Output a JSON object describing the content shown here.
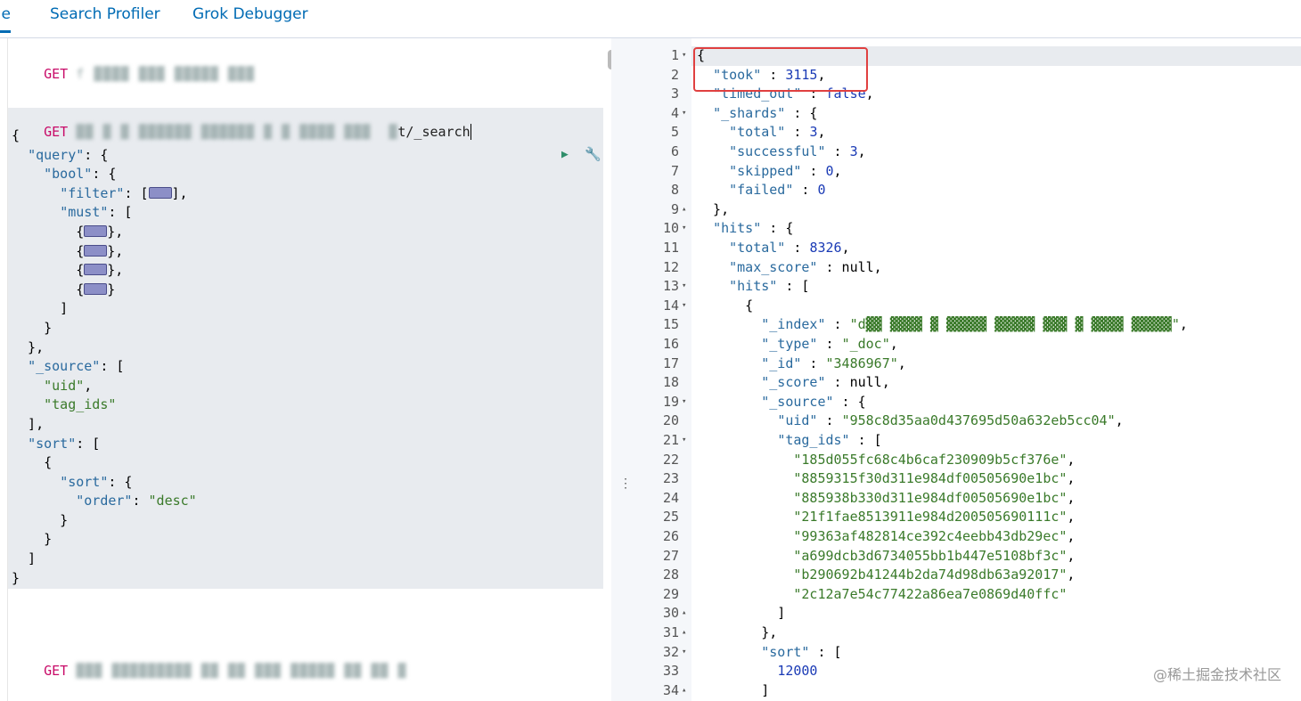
{
  "tabs": [
    {
      "label": "ble",
      "active": true
    },
    {
      "label": "Search Profiler",
      "active": false
    },
    {
      "label": "Grok Debugger",
      "active": false
    }
  ],
  "request": {
    "method": "GET",
    "first_path": "f ▓▓▓▓ ▓▓▓ ▓▓▓▓▓ ▓▓▓",
    "second_path_tail": "t/_search",
    "second_path_blur": "▓▓ ▓ ▓ ▓▓▓▓▓▓ ▓▓▓▓▓▓ ▓ ▓ ▓▓▓▓ ▓▓▓  ▓",
    "third_path": "▓▓▓ ▓▓▓▓▓▓▓▓▓ ▓▓ ▓▓ ▓▓▓ ▓▓▓▓▓ ▓▓ ▓▓ ▓",
    "body_lines": [
      "{",
      "  \"query\": {",
      "    \"bool\": {",
      "      \"filter\": [▭],",
      "      \"must\": [",
      "        {▭},",
      "        {▭},",
      "        {▭},",
      "        {▭}",
      "      ]",
      "    }",
      "  },",
      "  \"_source\": [",
      "    \"uid\",",
      "    \"tag_ids\"",
      "  ],",
      "  \"sort\": [",
      "    {",
      "      \"sort\": {",
      "        \"order\": \"desc\"",
      "      }",
      "    }",
      "  ]",
      "}"
    ]
  },
  "response": {
    "lines": [
      {
        "n": "1",
        "fold": "▾",
        "text": "{"
      },
      {
        "n": "2",
        "fold": "",
        "text": "  \"took\" : 3115,"
      },
      {
        "n": "3",
        "fold": "",
        "text": "  \"timed_out\" : false,"
      },
      {
        "n": "4",
        "fold": "▾",
        "text": "  \"_shards\" : {"
      },
      {
        "n": "5",
        "fold": "",
        "text": "    \"total\" : 3,"
      },
      {
        "n": "6",
        "fold": "",
        "text": "    \"successful\" : 3,"
      },
      {
        "n": "7",
        "fold": "",
        "text": "    \"skipped\" : 0,"
      },
      {
        "n": "8",
        "fold": "",
        "text": "    \"failed\" : 0"
      },
      {
        "n": "9",
        "fold": "▴",
        "text": "  },"
      },
      {
        "n": "10",
        "fold": "▾",
        "text": "  \"hits\" : {"
      },
      {
        "n": "11",
        "fold": "",
        "text": "    \"total\" : 8326,"
      },
      {
        "n": "12",
        "fold": "",
        "text": "    \"max_score\" : null,"
      },
      {
        "n": "13",
        "fold": "▾",
        "text": "    \"hits\" : ["
      },
      {
        "n": "14",
        "fold": "▾",
        "text": "      {"
      },
      {
        "n": "15",
        "fold": "",
        "text": "        \"_index\" : \"d▓▓ ▓▓▓▓ ▓ ▓▓▓▓▓ ▓▓▓▓▓ ▓▓▓ ▓ ▓▓▓▓ ▓▓▓▓▓\","
      },
      {
        "n": "16",
        "fold": "",
        "text": "        \"_type\" : \"_doc\","
      },
      {
        "n": "17",
        "fold": "",
        "text": "        \"_id\" : \"3486967\","
      },
      {
        "n": "18",
        "fold": "",
        "text": "        \"_score\" : null,"
      },
      {
        "n": "19",
        "fold": "▾",
        "text": "        \"_source\" : {"
      },
      {
        "n": "20",
        "fold": "",
        "text": "          \"uid\" : \"958c8d35aa0d437695d50a632eb5cc04\","
      },
      {
        "n": "21",
        "fold": "▾",
        "text": "          \"tag_ids\" : ["
      },
      {
        "n": "22",
        "fold": "",
        "text": "            \"185d055fc68c4b6caf230909b5cf376e\","
      },
      {
        "n": "23",
        "fold": "",
        "text": "            \"8859315f30d311e984df00505690e1bc\","
      },
      {
        "n": "24",
        "fold": "",
        "text": "            \"885938b330d311e984df00505690e1bc\","
      },
      {
        "n": "25",
        "fold": "",
        "text": "            \"21f1fae8513911e984d200505690111c\","
      },
      {
        "n": "26",
        "fold": "",
        "text": "            \"99363af482814ce392c4eebb43db29ec\","
      },
      {
        "n": "27",
        "fold": "",
        "text": "            \"a699dcb3d6734055bb1b447e5108bf3c\","
      },
      {
        "n": "28",
        "fold": "",
        "text": "            \"b290692b41244b2da74d98db63a92017\","
      },
      {
        "n": "29",
        "fold": "",
        "text": "            \"2c12a7e54c77422a86ea7e0869d40ffc\""
      },
      {
        "n": "30",
        "fold": "▴",
        "text": "          ]"
      },
      {
        "n": "31",
        "fold": "▴",
        "text": "        },"
      },
      {
        "n": "32",
        "fold": "▾",
        "text": "        \"sort\" : ["
      },
      {
        "n": "33",
        "fold": "",
        "text": "          12000"
      },
      {
        "n": "34",
        "fold": "▴",
        "text": "        ]"
      }
    ]
  },
  "watermark": "@稀土掘金技术社区",
  "icons": {
    "play": "play-icon",
    "wrench": "wrench-icon",
    "resize": "resize-handle-icon"
  }
}
